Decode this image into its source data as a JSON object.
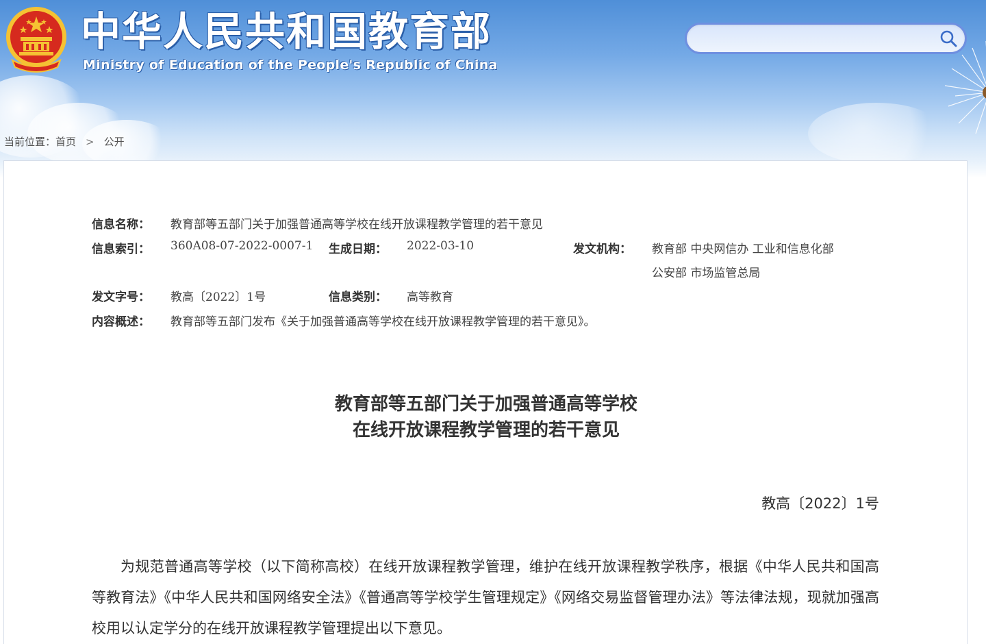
{
  "header": {
    "site_title": "中华人民共和国教育部",
    "site_subtitle": "Ministry of Education of the People's Republic of China",
    "search_placeholder": ""
  },
  "icons": {
    "emblem": "national-emblem-icon",
    "search": "search-icon"
  },
  "colors": {
    "header_blue": "#4f8fd8",
    "search_border": "#6e8fe0",
    "emblem_red": "#d62a1e",
    "emblem_gold": "#f5c233"
  },
  "breadcrumb": {
    "prefix": "当前位置：",
    "home": "首页",
    "separator": ">",
    "current": "公开"
  },
  "meta": {
    "name_label": "信息名称：",
    "name_value": "教育部等五部门关于加强普通高等学校在线开放课程教学管理的若干意见",
    "index_label": "信息索引：",
    "index_value": "360A08-07-2022-0007-1",
    "date_label": "生成日期：",
    "date_value": "2022-03-10",
    "issuer_label": "发文机构：",
    "issuer_line1": "教育部 中央网信办 工业和信息化部",
    "issuer_line2": "公安部 市场监管总局",
    "docno_label": "发文字号：",
    "docno_value": "教高〔2022〕1号",
    "category_label": "信息类别：",
    "category_value": "高等教育",
    "summary_label": "内容概述：",
    "summary_value": "教育部等五部门发布《关于加强普通高等学校在线开放课程教学管理的若干意见》。"
  },
  "document": {
    "title_line1": "教育部等五部门关于加强普通高等学校",
    "title_line2": "在线开放课程教学管理的若干意见",
    "number": "教高〔2022〕1号",
    "paragraph1": "为规范普通高等学校（以下简称高校）在线开放课程教学管理，维护在线开放课程教学秩序，根据《中华人民共和国高等教育法》《中华人民共和国网络安全法》《普通高等学校学生管理规定》《网络交易监督管理办法》等法律法规，现就加强高校用以认定学分的在线开放课程教学管理提出以下意见。"
  }
}
